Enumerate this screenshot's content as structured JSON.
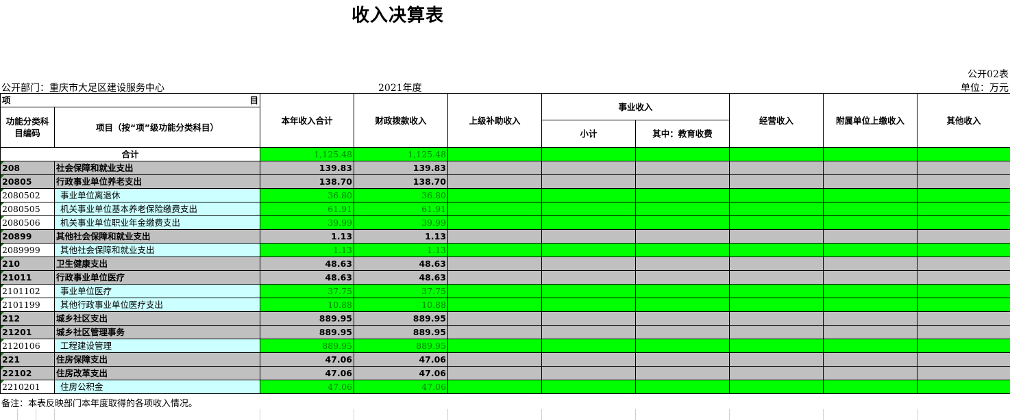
{
  "title": "收入决算表",
  "form_no": "公开02表",
  "department": "公开部门：重庆市大足区建设服务中心",
  "year": "2021年度",
  "unit": "单位：万元",
  "headers": {
    "item_left": "项",
    "item_right": "目",
    "code": "功能分类科目编码",
    "name": "项目（按“项”级功能分类科目）",
    "total_income": "本年收入合计",
    "fiscal": "财政拨款收入",
    "superior": "上级补助收入",
    "business": "事业收入",
    "subtotal": "小计",
    "education": "其中：教育收费",
    "operating": "经营收入",
    "affiliated": "附属单位上缴收入",
    "other": "其他收入"
  },
  "total_label": "合计",
  "total_values": [
    "1,125.48",
    "1,125.48"
  ],
  "rows": [
    {
      "code": "208",
      "name": "社会保障和就业支出",
      "v1": "139.83",
      "v2": "139.83",
      "level": "bold"
    },
    {
      "code": "20805",
      "name": "行政事业单位养老支出",
      "v1": "138.70",
      "v2": "138.70",
      "level": "bold"
    },
    {
      "code": "2080502",
      "name": "事业单位离退休",
      "v1": "36.80",
      "v2": "36.80",
      "level": "leaf"
    },
    {
      "code": "2080505",
      "name": "机关事业单位基本养老保险缴费支出",
      "v1": "61.91",
      "v2": "61.91",
      "level": "leaf"
    },
    {
      "code": "2080506",
      "name": "机关事业单位职业年金缴费支出",
      "v1": "39.99",
      "v2": "39.99",
      "level": "leaf"
    },
    {
      "code": "20899",
      "name": "其他社会保障和就业支出",
      "v1": "1.13",
      "v2": "1.13",
      "level": "bold"
    },
    {
      "code": "2089999",
      "name": "其他社会保障和就业支出",
      "v1": "1.13",
      "v2": "1.13",
      "level": "leaf"
    },
    {
      "code": "210",
      "name": "卫生健康支出",
      "v1": "48.63",
      "v2": "48.63",
      "level": "bold"
    },
    {
      "code": "21011",
      "name": "行政事业单位医疗",
      "v1": "48.63",
      "v2": "48.63",
      "level": "bold"
    },
    {
      "code": "2101102",
      "name": "事业单位医疗",
      "v1": "37.75",
      "v2": "37.75",
      "level": "leaf"
    },
    {
      "code": "2101199",
      "name": "其他行政事业单位医疗支出",
      "v1": "10.88",
      "v2": "10.88",
      "level": "leaf"
    },
    {
      "code": "212",
      "name": "城乡社区支出",
      "v1": "889.95",
      "v2": "889.95",
      "level": "bold"
    },
    {
      "code": "21201",
      "name": "城乡社区管理事务",
      "v1": "889.95",
      "v2": "889.95",
      "level": "bold"
    },
    {
      "code": "2120106",
      "name": "工程建设管理",
      "v1": "889.95",
      "v2": "889.95",
      "level": "leaf"
    },
    {
      "code": "221",
      "name": "住房保障支出",
      "v1": "47.06",
      "v2": "47.06",
      "level": "bold"
    },
    {
      "code": "22102",
      "name": "住房改革支出",
      "v1": "47.06",
      "v2": "47.06",
      "level": "bold"
    },
    {
      "code": "2210201",
      "name": "住房公积金",
      "v1": "47.06",
      "v2": "47.06",
      "level": "leaf"
    }
  ],
  "note": "备注：本表反映部门本年度取得的各项收入情况。",
  "colors": {
    "grey": "#c0c0c0",
    "green": "#00ff00",
    "cyan": "#ccffff",
    "leaf_text": "#008000"
  }
}
